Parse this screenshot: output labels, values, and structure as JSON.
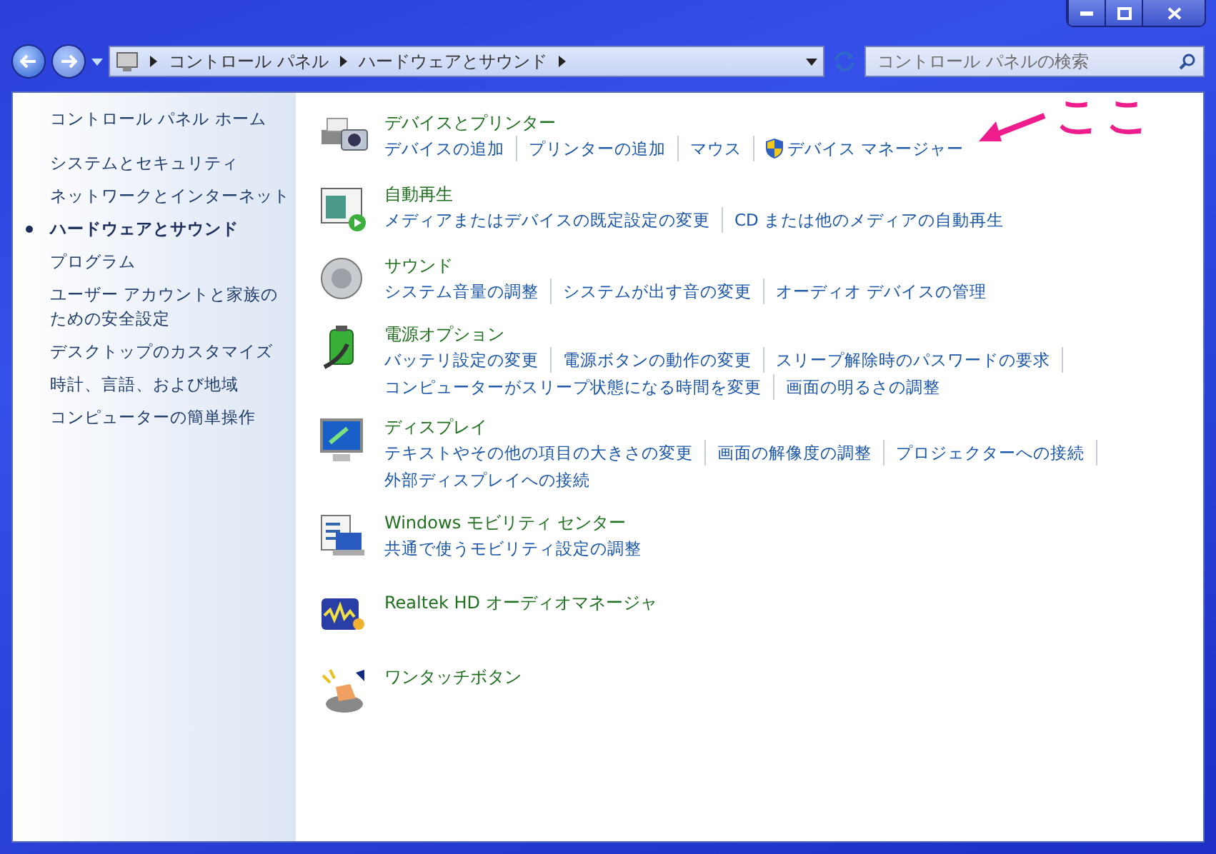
{
  "address_bar": {
    "breadcrumbs": [
      "コントロール パネル",
      "ハードウェアとサウンド"
    ]
  },
  "search": {
    "placeholder": "コントロール パネルの検索"
  },
  "sidebar": {
    "home": "コントロール パネル ホーム",
    "items": [
      {
        "label": "システムとセキュリティ",
        "selected": false
      },
      {
        "label": "ネットワークとインターネット",
        "selected": false
      },
      {
        "label": "ハードウェアとサウンド",
        "selected": true
      },
      {
        "label": "プログラム",
        "selected": false
      },
      {
        "label": "ユーザー アカウントと家族のための安全設定",
        "selected": false
      },
      {
        "label": "デスクトップのカスタマイズ",
        "selected": false
      },
      {
        "label": "時計、言語、および地域",
        "selected": false
      },
      {
        "label": "コンピューターの簡単操作",
        "selected": false
      }
    ]
  },
  "sections": [
    {
      "kind": "devices",
      "title": "デバイスとプリンター",
      "links": [
        {
          "label": "デバイスの追加",
          "shield": false
        },
        {
          "label": "プリンターの追加",
          "shield": false
        },
        {
          "label": "マウス",
          "shield": false
        },
        {
          "label": "デバイス マネージャー",
          "shield": true
        }
      ]
    },
    {
      "kind": "autoplay",
      "title": "自動再生",
      "links": [
        {
          "label": "メディアまたはデバイスの既定設定の変更",
          "shield": false
        },
        {
          "label": "CD または他のメディアの自動再生",
          "shield": false
        }
      ]
    },
    {
      "kind": "sound",
      "title": "サウンド",
      "links": [
        {
          "label": "システム音量の調整",
          "shield": false
        },
        {
          "label": "システムが出す音の変更",
          "shield": false
        },
        {
          "label": "オーディオ デバイスの管理",
          "shield": false
        }
      ]
    },
    {
      "kind": "power",
      "title": "電源オプション",
      "links": [
        {
          "label": "バッテリ設定の変更",
          "shield": false
        },
        {
          "label": "電源ボタンの動作の変更",
          "shield": false
        },
        {
          "label": "スリープ解除時のパスワードの要求",
          "shield": false
        },
        {
          "label": "コンピューターがスリープ状態になる時間を変更",
          "shield": false
        },
        {
          "label": "画面の明るさの調整",
          "shield": false
        }
      ]
    },
    {
      "kind": "display",
      "title": "ディスプレイ",
      "links": [
        {
          "label": "テキストやその他の項目の大きさの変更",
          "shield": false
        },
        {
          "label": "画面の解像度の調整",
          "shield": false
        },
        {
          "label": "プロジェクターへの接続",
          "shield": false
        },
        {
          "label": "外部ディスプレイへの接続",
          "shield": false
        }
      ]
    },
    {
      "kind": "mobility",
      "title": "Windows モビリティ センター",
      "links": [
        {
          "label": "共通で使うモビリティ設定の調整",
          "shield": false
        }
      ]
    },
    {
      "kind": "audio",
      "title": "Realtek HD オーディオマネージャ"
    },
    {
      "kind": "onetouch",
      "title": "ワンタッチボタン"
    }
  ],
  "annotation": {
    "text": "ここ"
  }
}
